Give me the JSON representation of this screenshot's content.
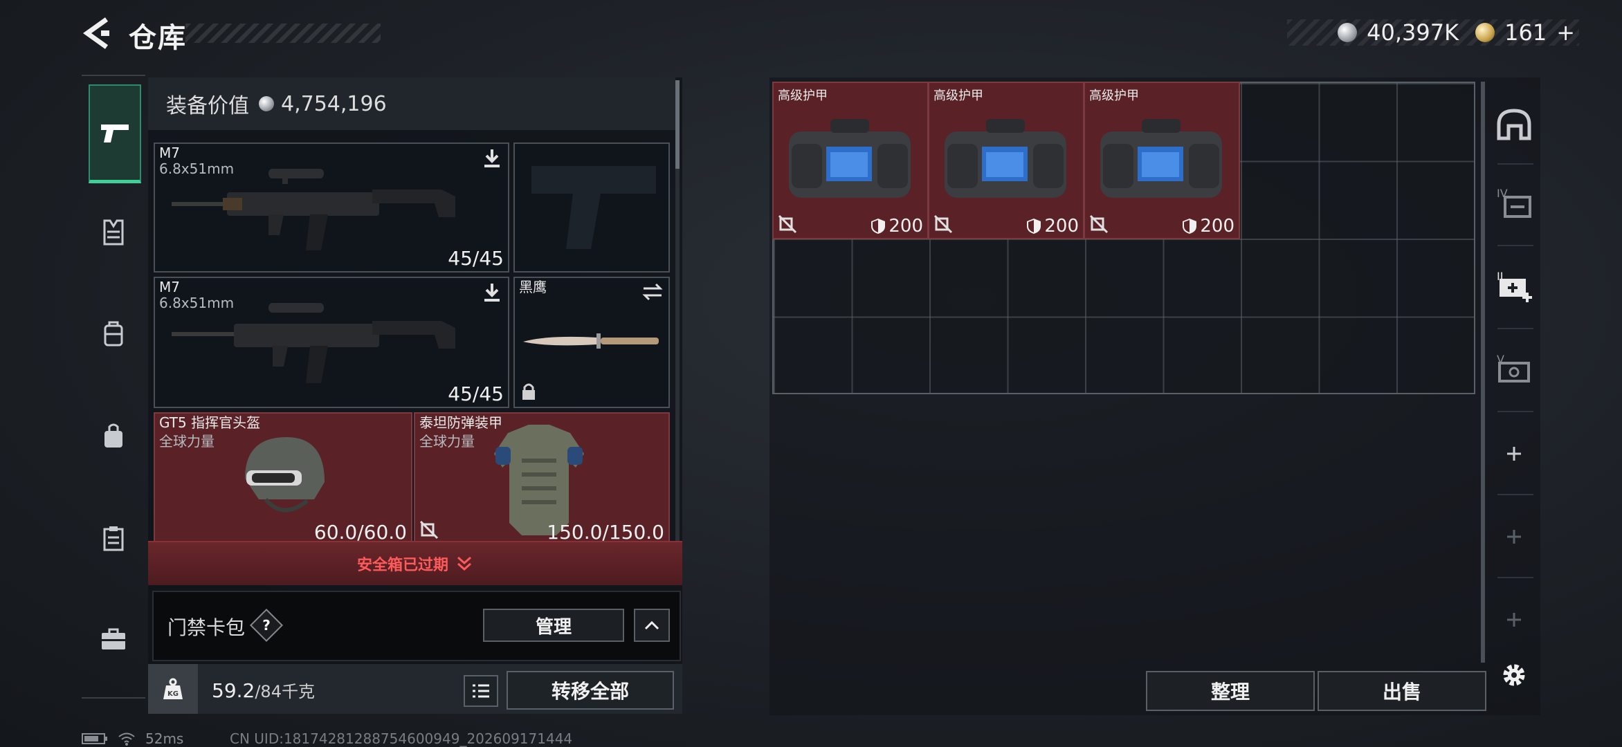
{
  "header": {
    "title": "仓库",
    "currency_silver": "40,397K",
    "currency_gold": "161",
    "gold_add": "+"
  },
  "equip": {
    "value_label": "装备价值",
    "value": "4,754,196"
  },
  "slots": {
    "primary1": {
      "name": "M7",
      "ammo_type": "6.8x51mm",
      "ammo": "45/45"
    },
    "primary2": {
      "name": "M7",
      "ammo_type": "6.8x51mm",
      "ammo": "45/45"
    },
    "melee": {
      "name": "黑鹰"
    },
    "helmet": {
      "name": "GT5 指挥官头盔",
      "brand": "全球力量",
      "durability": "60.0/60.0"
    },
    "armor": {
      "name": "泰坦防弹装甲",
      "brand": "全球力量",
      "durability": "150.0/150.0"
    }
  },
  "safebox": {
    "label": "安全箱已过期"
  },
  "cardpack": {
    "label": "门禁卡包",
    "help": "?",
    "manage": "管理"
  },
  "weight": {
    "current": "59.2",
    "capacity": "/84千克"
  },
  "transfer_all": "转移全部",
  "stash_items": [
    {
      "name": "高级护甲",
      "durability": "200"
    },
    {
      "name": "高级护甲",
      "durability": "200"
    },
    {
      "name": "高级护甲",
      "durability": "200"
    }
  ],
  "actions": {
    "tidy": "整理",
    "sell": "出售"
  },
  "status": {
    "ping": "52ms",
    "uid": "CN UID:18174281288754600949_202609171444"
  },
  "colors": {
    "accent_green": "#3fcf98",
    "item_red": "#5a2227",
    "warning_red": "#ff5a5a"
  },
  "icons": [
    "back-arrow-icon",
    "pistol-icon",
    "vest-icon",
    "backpack-icon",
    "bag-icon",
    "clipboard-icon",
    "briefcase-icon",
    "helmet-side-icon",
    "weapon-case-icon",
    "medkit-plus-icon",
    "cash-icon",
    "plus-icon",
    "gear-icon",
    "weight-icon",
    "list-icon",
    "wifi-icon",
    "battery-icon"
  ]
}
